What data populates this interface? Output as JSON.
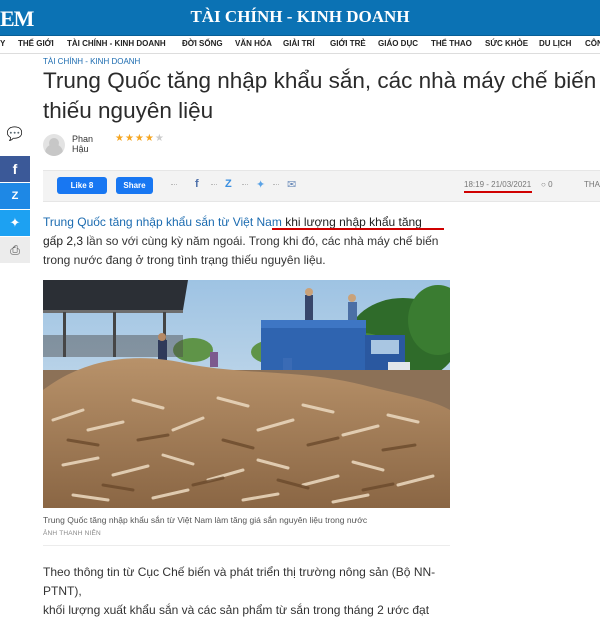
{
  "header": {
    "logo": "EM",
    "section_title": "TÀI CHÍNH - KINH DOANH"
  },
  "nav": {
    "items": [
      "Y",
      "THẾ GIỚI",
      "TÀI CHÍNH - KINH DOANH",
      "ĐỜI SỐNG",
      "VĂN HÓA",
      "GIẢI TRÍ",
      "GIỚI TRẺ",
      "GIÁO DỤC",
      "THỂ THAO",
      "SỨC KHỎE",
      "DU LỊCH",
      "CÔN"
    ]
  },
  "article": {
    "breadcrumb": "TÀI CHÍNH - KINH DOANH",
    "title_line1": "Trung Quốc tăng nhập khẩu sắn, các nhà máy chế biến",
    "title_line2": "thiếu nguyên liệu",
    "author": "Phan Hậu",
    "rating_stars": 4,
    "rating_max": 5,
    "date": "18:19 - 21/03/2021",
    "comment_count": "0",
    "tha": "THA",
    "lead_link": "Trung Quốc tăng nhập khẩu sắn từ Việt Nam",
    "lead_highlight": "khi lượng nhập khẩu tăng gấp 2,3",
    "lead_rest": "lần so với cùng kỳ năm ngoái. Trong khi đó, các nhà máy chế biến trong nước đang ở trong tình trạng thiếu nguyên liệu.",
    "photo_caption": "Trung Quốc tăng nhập khẩu sắn từ Việt Nam làm tăng giá sắn nguyên liệu trong nước",
    "photo_credit": "ẢNH THANH NIÊN",
    "body_line1": "Theo thông tin từ Cục Chế biến và phát triển thị trường nông sản (Bộ NN-PTNT),",
    "body_line2": "khối lượng xuất khẩu sắn và các sản phẩm từ sắn trong tháng 2 ước đạt"
  },
  "share": {
    "like_label": "Like 8",
    "share_label": "Share"
  },
  "colors": {
    "brand_blue": "#0b72b4",
    "facebook_blue": "#1877f2",
    "link_blue": "#1b6bb0",
    "underline_red": "#d00000",
    "star": "#f5a623"
  }
}
